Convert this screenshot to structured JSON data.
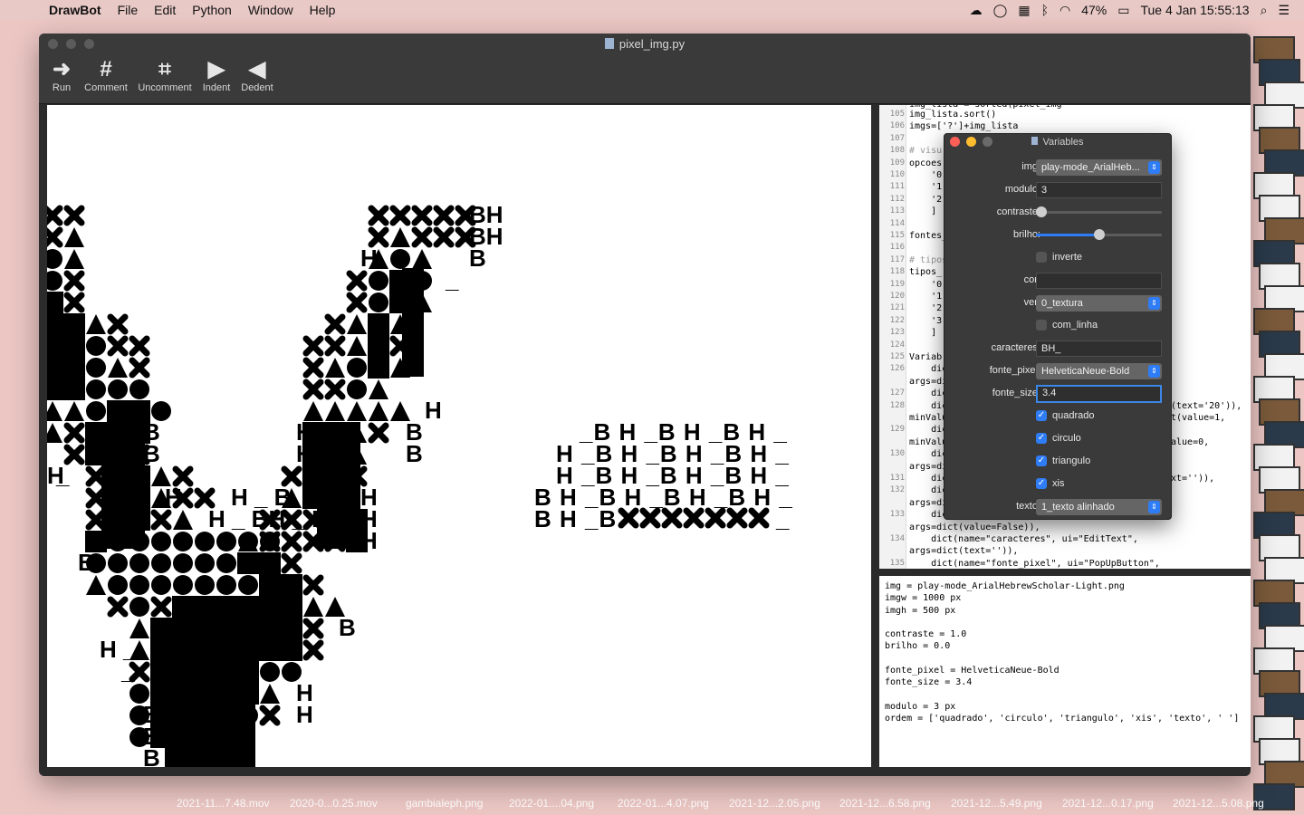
{
  "menubar": {
    "app": "DrawBot",
    "items": [
      "File",
      "Edit",
      "Python",
      "Window",
      "Help"
    ],
    "battery": "47%",
    "datetime": "Tue 4 Jan  15:55:13"
  },
  "window": {
    "title": "pixel_img.py",
    "toolbar": [
      {
        "label": "Run",
        "icon": "run-arrow-icon",
        "glyph": "➜"
      },
      {
        "label": "Comment",
        "icon": "hash-icon",
        "glyph": "#"
      },
      {
        "label": "Uncomment",
        "icon": "uncomment-hash-icon",
        "glyph": "⌗"
      },
      {
        "label": "Indent",
        "icon": "indent-icon",
        "glyph": "▶"
      },
      {
        "label": "Dedent",
        "icon": "dedent-icon",
        "glyph": "◀"
      }
    ]
  },
  "code": {
    "lines": [
      {
        "n": "105",
        "t": "img_lista.sort()"
      },
      {
        "n": "106",
        "t": "imgs=['?']+img_lista"
      },
      {
        "n": "107",
        "t": ""
      },
      {
        "n": "108",
        "t": "# visu"
      },
      {
        "n": "109",
        "t": "opcoes"
      },
      {
        "n": "110",
        "t": "    '0"
      },
      {
        "n": "111",
        "t": "    '1"
      },
      {
        "n": "112",
        "t": "    '2"
      },
      {
        "n": "113",
        "t": "    ]"
      },
      {
        "n": "114",
        "t": ""
      },
      {
        "n": "115",
        "t": "fontes_"
      },
      {
        "n": "116",
        "t": ""
      },
      {
        "n": "117",
        "t": "# tipos"
      },
      {
        "n": "118",
        "t": "tipos_"
      },
      {
        "n": "119",
        "t": "    '0"
      },
      {
        "n": "120",
        "t": "    '1"
      },
      {
        "n": "121",
        "t": "    '2"
      },
      {
        "n": "122",
        "t": "    '3"
      },
      {
        "n": "123",
        "t": "    ]"
      },
      {
        "n": "124",
        "t": ""
      },
      {
        "n": "125",
        "t": "Variab"
      },
      {
        "n": "126",
        "t": "    dic"
      },
      {
        "n": "",
        "t": "args=di"
      },
      {
        "n": "127",
        "t": "    dic"
      },
      {
        "n": "128",
        "t": "    dic"
      },
      {
        "n": "",
        "t": "minValu"
      },
      {
        "n": "129",
        "t": "    dic"
      },
      {
        "n": "",
        "t": "minValu"
      },
      {
        "n": "130",
        "t": "    dic"
      },
      {
        "n": "",
        "t": "args=di"
      },
      {
        "n": "131",
        "t": "    dic"
      },
      {
        "n": "132",
        "t": "    dic"
      },
      {
        "n": "",
        "t": "args=di"
      },
      {
        "n": "133",
        "t": "    dic"
      },
      {
        "n": "",
        "t": "args=dict(value=False)),"
      },
      {
        "n": "134",
        "t": "    dict(name=\"caracteres\", ui=\"EditText\","
      },
      {
        "n": "",
        "t": "args=dict(text='')),"
      },
      {
        "n": "135",
        "t": "    dict(name=\"fonte_pixel\", ui=\"PopUpButton\","
      }
    ],
    "right_fragments": [
      {
        "row": 24,
        "t": "(text='20')),"
      },
      {
        "row": 25,
        "t": "t(value=1,"
      },
      {
        "row": 27,
        "t": "alue=0,"
      },
      {
        "row": 30,
        "t": "xt='')),"
      }
    ],
    "top_partial": "img_lista = sorted(pixel_img"
  },
  "output": {
    "text": "img = play-mode_ArialHebrewScholar-Light.png\nimgw = 1000 px\nimgh = 500 px\n\ncontraste = 1.0\nbrilho = 0.0\n\nfonte_pixel = HelveticaNeue-Bold\nfonte_size = 3.4\n\nmodulo = 3 px\nordem = ['quadrado', 'circulo', 'triangulo', 'xis', 'texto', ' ']"
  },
  "variables": {
    "title": "Variables",
    "img_label": "img:",
    "img_value": "play-mode_ArialHeb...",
    "modulo_label": "modulo:",
    "modulo_value": "3",
    "contraste_label": "contraste:",
    "contraste_level": 0.0,
    "brilho_label": "brilho:",
    "brilho_level": 0.5,
    "inverte_label": "inverte",
    "inverte_checked": false,
    "cor_label": "cor:",
    "cor_value": "",
    "ver_label": "ver:",
    "ver_value": "0_textura",
    "com_linha_label": "com_linha",
    "com_linha_checked": false,
    "caracteres_label": "caracteres:",
    "caracteres_value": "BH_",
    "fonte_pixel_label": "fonte_pixel:",
    "fonte_pixel_value": "HelveticaNeue-Bold",
    "fonte_size_label": "fonte_size:",
    "fonte_size_value": "3.4",
    "quadrado_label": "quadrado",
    "quadrado_checked": true,
    "circulo_label": "circulo",
    "circulo_checked": true,
    "triangulo_label": "triangulo",
    "triangulo_checked": true,
    "xis_label": "xis",
    "xis_checked": true,
    "texto_label": "texto:",
    "texto_value": "1_texto alinhado"
  },
  "canvas": {
    "text_rows": [
      {
        "t": "_BH_BH_BH_"
      },
      {
        "t": "H_BH_BH_BH_"
      },
      {
        "t": "H_BH_BH_BH_"
      },
      {
        "t": "BH_BH_BH_BH_"
      },
      {
        "t": "BH_B"
      }
    ]
  },
  "desktop": {
    "labels": [
      "2021-11...7.48.mov",
      "2020-0...0.25.mov",
      "gambialeph.png",
      "2022-01....04.png",
      "2022-01...4.07.png",
      "2021-12...2.05.png",
      "2021-12...6.58.png",
      "2021-12...5.49.png",
      "2021-12...0.17.png",
      "2021-12...5.08.png"
    ]
  }
}
